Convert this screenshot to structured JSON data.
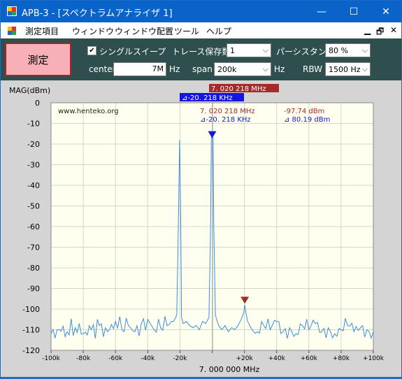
{
  "window": {
    "title": "APB-3 - [スペクトラムアナライザ 1]",
    "minimize": "—",
    "maximize": "☐",
    "close": "✕"
  },
  "menu": {
    "items": [
      "測定項目",
      "ウィンドウ",
      "ウィンドウ配置",
      "ツール",
      "ヘルプ"
    ],
    "mdi_minimize": "▁",
    "mdi_restore": "🗗",
    "mdi_close": "✕"
  },
  "toolbar": {
    "measure_label": "測定",
    "single_sweep_label": "シングルスイープ",
    "single_sweep_checked": "✔",
    "trace_keep_label": "トレース保存数",
    "trace_keep_value": "1",
    "persistence_label": "パーシスタンス",
    "persistence_value": "80 %",
    "center_label": "center",
    "center_value": "7M",
    "center_unit": "Hz",
    "span_label": "span",
    "span_value": "200k",
    "span_unit": "Hz",
    "rbw_label": "RBW",
    "rbw_value": "1500 Hz"
  },
  "chart": {
    "ylabel": "MAG(dBm)",
    "watermark": "www.henteko.org",
    "marker_freq_box": "7. 020 218 MHz",
    "delta_freq_box": "⊿-20. 218 KHz",
    "readout_freq": "7. 020 218 MHz",
    "readout_level": "-97.74 dBm",
    "readout_delta_freq": "⊿-20. 218 KHz",
    "readout_delta_level": "⊿ 80.19 dBm",
    "center_freq_label": "7. 000 000 MHz",
    "colors": {
      "trace": "#3a8ee0",
      "marker": "#a52a2a",
      "delta": "#1515d8",
      "plot_bg": "#fffff0",
      "grid": "#d0d8c8"
    }
  },
  "chart_data": {
    "type": "line",
    "xlabel": "",
    "ylabel": "MAG(dBm)",
    "x_tick_labels": [
      "-100k",
      "-80k",
      "-60k",
      "-40k",
      "-20k",
      "0",
      "+20k",
      "+40k",
      "+60k",
      "+80k",
      "+100k"
    ],
    "y_tick_labels": [
      "0",
      "-10",
      "-20",
      "-30",
      "-40",
      "-50",
      "-60",
      "-70",
      "-80",
      "-90",
      "-100",
      "-110",
      "-120"
    ],
    "xlim": [
      -100,
      100
    ],
    "ylim": [
      -120,
      0
    ],
    "grid": true,
    "series": [
      {
        "x": [
          -100,
          -95,
          -90,
          -85,
          -80,
          -75,
          -70,
          -65,
          -60,
          -56,
          -52,
          -48,
          -44,
          -40,
          -36,
          -32,
          -28,
          -24,
          -22,
          -21,
          -20.2,
          -19.5,
          -19,
          -18,
          -16,
          -14,
          -12,
          -10,
          -8,
          -6,
          -4,
          -2,
          -1,
          -0.5,
          0,
          0.5,
          1,
          2,
          4,
          6,
          8,
          10,
          12,
          14,
          16,
          18,
          19.5,
          20.2,
          21,
          22,
          24,
          28,
          32,
          36,
          40,
          44,
          48,
          52,
          56,
          60,
          64,
          68,
          72,
          76,
          80,
          84,
          88,
          92,
          96,
          100
        ],
        "y": [
          -112,
          -110,
          -111,
          -109,
          -112,
          -110,
          -108,
          -111,
          -106,
          -110,
          -108,
          -111,
          -107,
          -105,
          -110,
          -109,
          -108,
          -106,
          -103,
          -60,
          -18,
          -60,
          -104,
          -107,
          -106,
          -108,
          -109,
          -108,
          -110,
          -106,
          -107,
          -104,
          -60,
          -17,
          -16,
          -17,
          -60,
          -103,
          -108,
          -110,
          -108,
          -111,
          -109,
          -110,
          -108,
          -105,
          -102,
          -98,
          -102,
          -106,
          -109,
          -111,
          -108,
          -110,
          -106,
          -111,
          -109,
          -112,
          -108,
          -110,
          -107,
          -111,
          -109,
          -112,
          -110,
          -108,
          -111,
          -109,
          -110,
          -111
        ]
      }
    ],
    "markers": [
      {
        "name": "delta",
        "x": 0.0,
        "y": -17.5
      },
      {
        "name": "main",
        "x": 20.218,
        "y": -97.74
      }
    ]
  }
}
